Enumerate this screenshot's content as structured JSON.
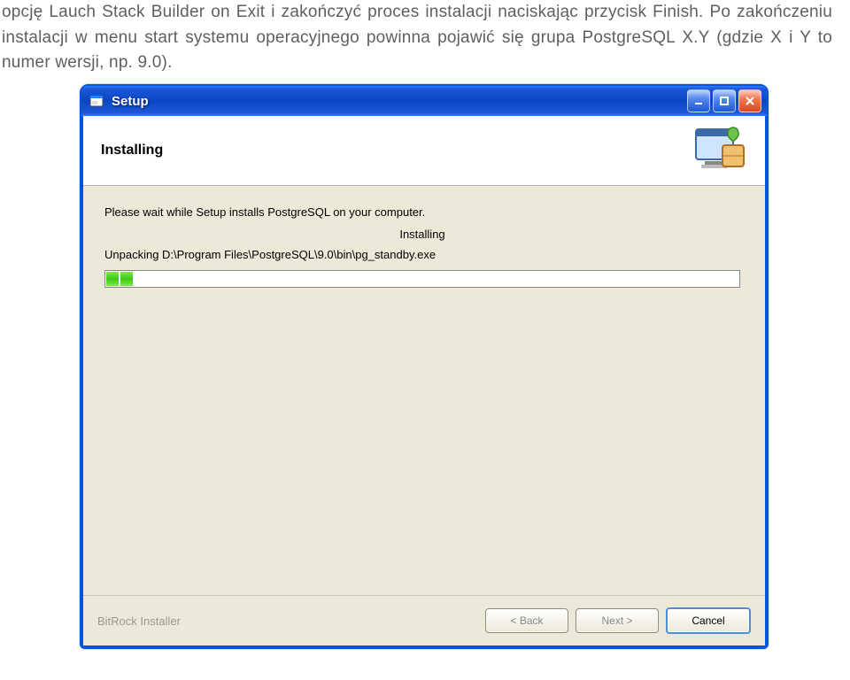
{
  "doc": {
    "paragraph": "opcję Lauch Stack Builder on Exit i zakończyć proces instalacji naciskając przycisk Finish. Po zakończeniu instalacji w menu start systemu operacyjnego powinna pojawić się grupa PostgreSQL X.Y (gdzie X i Y to numer wersji, np. 9.0)."
  },
  "window": {
    "title": "Setup",
    "header": {
      "heading": "Installing"
    },
    "content": {
      "message": "Please wait while Setup installs PostgreSQL on your computer.",
      "status": "Installing",
      "path": "Unpacking D:\\Program Files\\PostgreSQL\\9.0\\bin\\pg_standby.exe"
    },
    "footer": {
      "brand": "BitRock Installer",
      "back": "< Back",
      "next": "Next >",
      "cancel": "Cancel"
    }
  }
}
